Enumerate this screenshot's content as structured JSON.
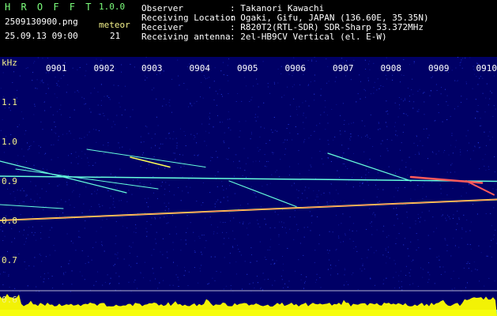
{
  "header": {
    "app_title": "H R O F F T",
    "version": "1.0.0",
    "filename": "2509130900.png",
    "timestamp": "25.09.13 09:00",
    "meteor_label": "meteor",
    "meteor_count": "21",
    "info_labels": [
      "Observer",
      "Receiving Location",
      "Receiver",
      "Receiving antenna"
    ],
    "info_values": [
      ": Takanori Kawachi",
      ": Ogaki, Gifu, JAPAN (136.60E, 35.35N)",
      ": R820T2(RTL-SDR) SDR-Sharp 53.372MHz",
      ": 2el-HB9CV Vertical (el. E-W)"
    ]
  },
  "spectrogram": {
    "y_unit": "kHz",
    "y_ticks": [
      "1.1",
      "1.0",
      "0.9",
      "0.8",
      "0.7",
      "0.6"
    ],
    "time_ticks": [
      "0901",
      "0902",
      "0903",
      "0904",
      "0905",
      "0906",
      "0907",
      "0908",
      "0909",
      "0910"
    ],
    "colors": {
      "background": "#000066",
      "tick_label": "#f5f28a",
      "time_label": "#ffffff",
      "signal_hot": "#ff5a5a",
      "signal_warm": "#ffff55",
      "signal_cool": "#66ffdd",
      "level_fill": "#ffff00",
      "level_base": "#55ccff"
    }
  }
}
